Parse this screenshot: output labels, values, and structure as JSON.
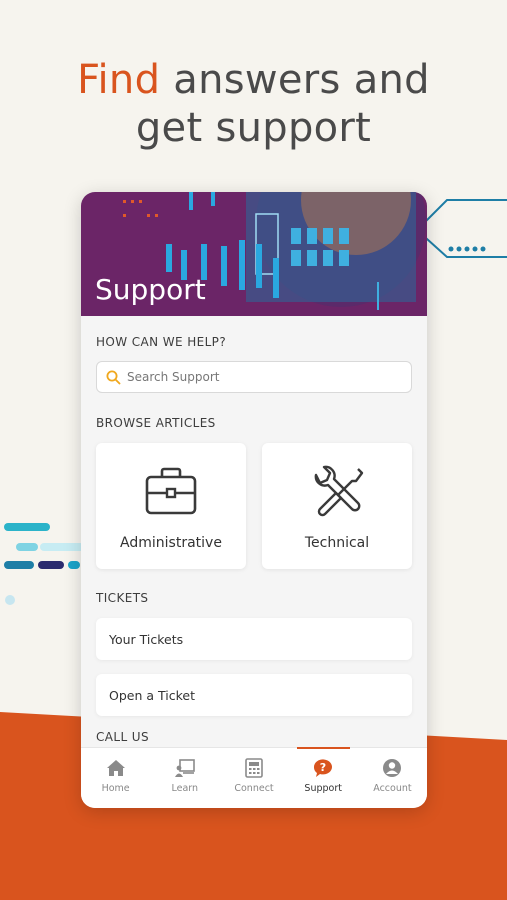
{
  "headline": {
    "accent": "Find",
    "rest_line1": " answers and",
    "line2": "get support"
  },
  "colors": {
    "accent": "#d9541e",
    "hero_bg": "#6b2567",
    "teal": "#1aa3c9"
  },
  "app": {
    "hero_title": "Support",
    "help_label": "HOW CAN WE HELP?",
    "search": {
      "placeholder": "Search Support",
      "icon": "search-icon"
    },
    "browse_label": "BROWSE ARTICLES",
    "articles": [
      {
        "label": "Administrative",
        "icon": "briefcase-icon"
      },
      {
        "label": "Technical",
        "icon": "wrench-screwdriver-icon"
      }
    ],
    "tickets_label": "TICKETS",
    "tickets": [
      {
        "label": "Your Tickets"
      },
      {
        "label": "Open a Ticket"
      }
    ],
    "call_label": "CALL US",
    "tabs": [
      {
        "label": "Home",
        "icon": "home-icon"
      },
      {
        "label": "Learn",
        "icon": "learn-icon"
      },
      {
        "label": "Connect",
        "icon": "connect-icon"
      },
      {
        "label": "Support",
        "icon": "support-icon",
        "active": true
      },
      {
        "label": "Account",
        "icon": "account-icon"
      }
    ]
  }
}
